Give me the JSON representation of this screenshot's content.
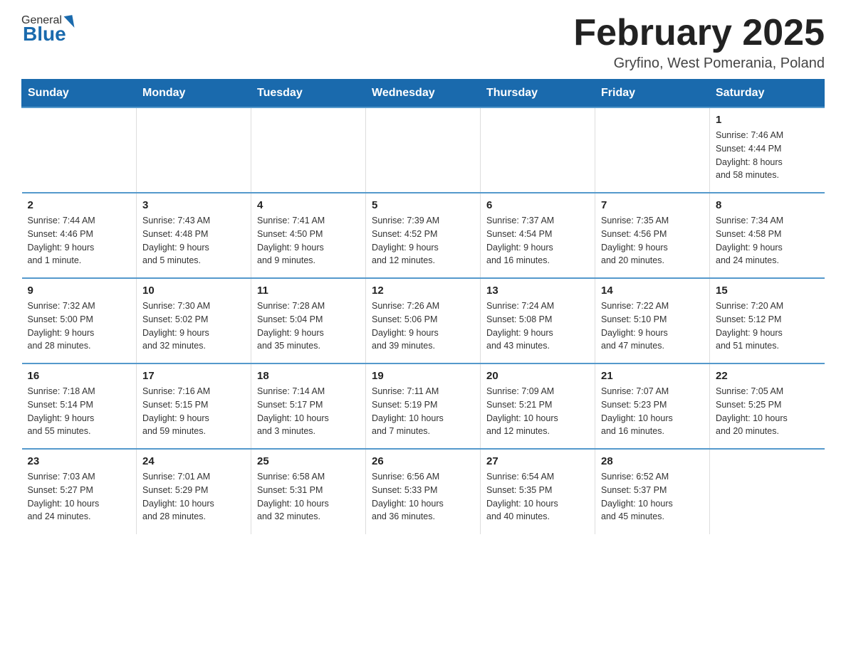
{
  "header": {
    "title": "February 2025",
    "location": "Gryfino, West Pomerania, Poland",
    "logo_general": "General",
    "logo_blue": "Blue"
  },
  "weekdays": [
    "Sunday",
    "Monday",
    "Tuesday",
    "Wednesday",
    "Thursday",
    "Friday",
    "Saturday"
  ],
  "weeks": [
    [
      {
        "day": "",
        "info": ""
      },
      {
        "day": "",
        "info": ""
      },
      {
        "day": "",
        "info": ""
      },
      {
        "day": "",
        "info": ""
      },
      {
        "day": "",
        "info": ""
      },
      {
        "day": "",
        "info": ""
      },
      {
        "day": "1",
        "info": "Sunrise: 7:46 AM\nSunset: 4:44 PM\nDaylight: 8 hours\nand 58 minutes."
      }
    ],
    [
      {
        "day": "2",
        "info": "Sunrise: 7:44 AM\nSunset: 4:46 PM\nDaylight: 9 hours\nand 1 minute."
      },
      {
        "day": "3",
        "info": "Sunrise: 7:43 AM\nSunset: 4:48 PM\nDaylight: 9 hours\nand 5 minutes."
      },
      {
        "day": "4",
        "info": "Sunrise: 7:41 AM\nSunset: 4:50 PM\nDaylight: 9 hours\nand 9 minutes."
      },
      {
        "day": "5",
        "info": "Sunrise: 7:39 AM\nSunset: 4:52 PM\nDaylight: 9 hours\nand 12 minutes."
      },
      {
        "day": "6",
        "info": "Sunrise: 7:37 AM\nSunset: 4:54 PM\nDaylight: 9 hours\nand 16 minutes."
      },
      {
        "day": "7",
        "info": "Sunrise: 7:35 AM\nSunset: 4:56 PM\nDaylight: 9 hours\nand 20 minutes."
      },
      {
        "day": "8",
        "info": "Sunrise: 7:34 AM\nSunset: 4:58 PM\nDaylight: 9 hours\nand 24 minutes."
      }
    ],
    [
      {
        "day": "9",
        "info": "Sunrise: 7:32 AM\nSunset: 5:00 PM\nDaylight: 9 hours\nand 28 minutes."
      },
      {
        "day": "10",
        "info": "Sunrise: 7:30 AM\nSunset: 5:02 PM\nDaylight: 9 hours\nand 32 minutes."
      },
      {
        "day": "11",
        "info": "Sunrise: 7:28 AM\nSunset: 5:04 PM\nDaylight: 9 hours\nand 35 minutes."
      },
      {
        "day": "12",
        "info": "Sunrise: 7:26 AM\nSunset: 5:06 PM\nDaylight: 9 hours\nand 39 minutes."
      },
      {
        "day": "13",
        "info": "Sunrise: 7:24 AM\nSunset: 5:08 PM\nDaylight: 9 hours\nand 43 minutes."
      },
      {
        "day": "14",
        "info": "Sunrise: 7:22 AM\nSunset: 5:10 PM\nDaylight: 9 hours\nand 47 minutes."
      },
      {
        "day": "15",
        "info": "Sunrise: 7:20 AM\nSunset: 5:12 PM\nDaylight: 9 hours\nand 51 minutes."
      }
    ],
    [
      {
        "day": "16",
        "info": "Sunrise: 7:18 AM\nSunset: 5:14 PM\nDaylight: 9 hours\nand 55 minutes."
      },
      {
        "day": "17",
        "info": "Sunrise: 7:16 AM\nSunset: 5:15 PM\nDaylight: 9 hours\nand 59 minutes."
      },
      {
        "day": "18",
        "info": "Sunrise: 7:14 AM\nSunset: 5:17 PM\nDaylight: 10 hours\nand 3 minutes."
      },
      {
        "day": "19",
        "info": "Sunrise: 7:11 AM\nSunset: 5:19 PM\nDaylight: 10 hours\nand 7 minutes."
      },
      {
        "day": "20",
        "info": "Sunrise: 7:09 AM\nSunset: 5:21 PM\nDaylight: 10 hours\nand 12 minutes."
      },
      {
        "day": "21",
        "info": "Sunrise: 7:07 AM\nSunset: 5:23 PM\nDaylight: 10 hours\nand 16 minutes."
      },
      {
        "day": "22",
        "info": "Sunrise: 7:05 AM\nSunset: 5:25 PM\nDaylight: 10 hours\nand 20 minutes."
      }
    ],
    [
      {
        "day": "23",
        "info": "Sunrise: 7:03 AM\nSunset: 5:27 PM\nDaylight: 10 hours\nand 24 minutes."
      },
      {
        "day": "24",
        "info": "Sunrise: 7:01 AM\nSunset: 5:29 PM\nDaylight: 10 hours\nand 28 minutes."
      },
      {
        "day": "25",
        "info": "Sunrise: 6:58 AM\nSunset: 5:31 PM\nDaylight: 10 hours\nand 32 minutes."
      },
      {
        "day": "26",
        "info": "Sunrise: 6:56 AM\nSunset: 5:33 PM\nDaylight: 10 hours\nand 36 minutes."
      },
      {
        "day": "27",
        "info": "Sunrise: 6:54 AM\nSunset: 5:35 PM\nDaylight: 10 hours\nand 40 minutes."
      },
      {
        "day": "28",
        "info": "Sunrise: 6:52 AM\nSunset: 5:37 PM\nDaylight: 10 hours\nand 45 minutes."
      },
      {
        "day": "",
        "info": ""
      }
    ]
  ]
}
